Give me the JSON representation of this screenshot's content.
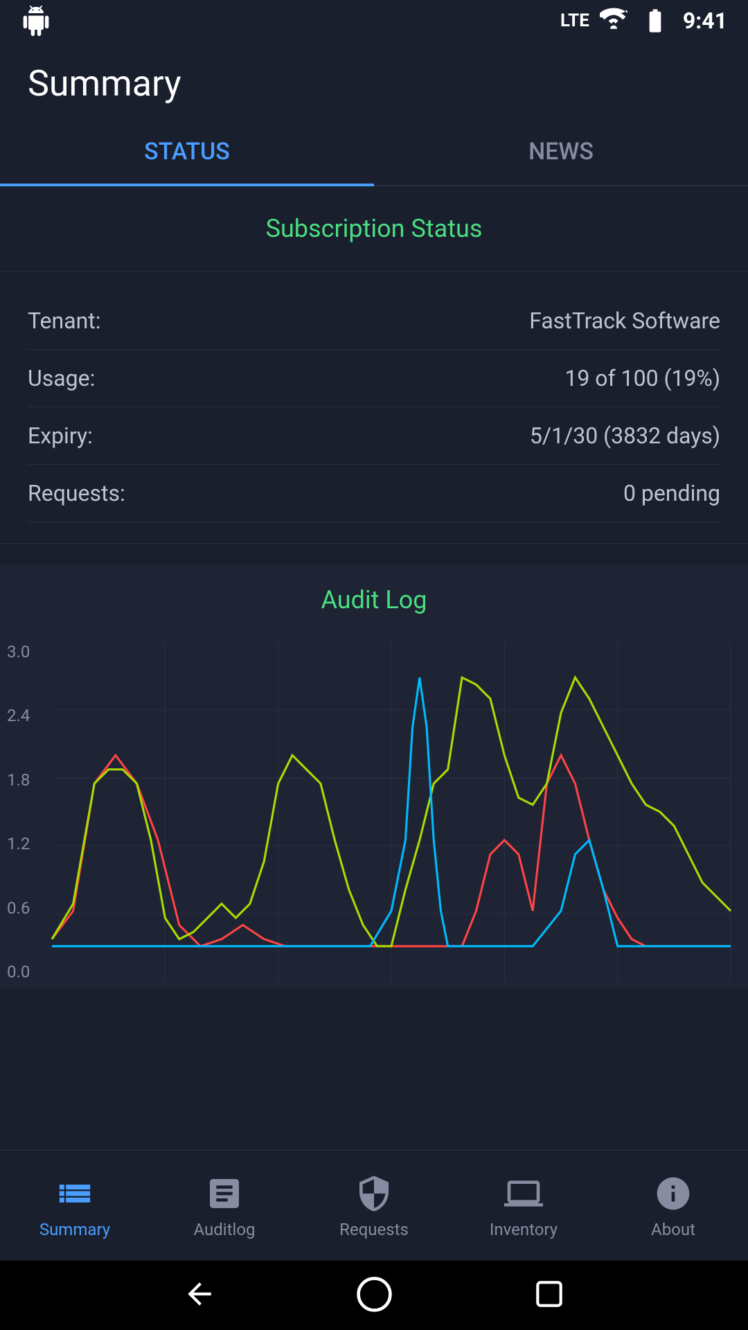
{
  "statusBar": {
    "time": "9:41",
    "networkType": "LTE"
  },
  "header": {
    "title": "Summary"
  },
  "tabs": [
    {
      "id": "status",
      "label": "STATUS",
      "active": true
    },
    {
      "id": "news",
      "label": "NEWS",
      "active": false
    }
  ],
  "subscriptionStatus": {
    "sectionTitle": "Subscription Status",
    "fields": [
      {
        "label": "Tenant:",
        "value": "FastTrack Software"
      },
      {
        "label": "Usage:",
        "value": "19 of 100 (19%)"
      },
      {
        "label": "Expiry:",
        "value": "5/1/30 (3832 days)"
      },
      {
        "label": "Requests:",
        "value": "0 pending"
      }
    ]
  },
  "auditLog": {
    "sectionTitle": "Audit Log",
    "yAxis": [
      "3.0",
      "2.4",
      "1.8",
      "1.2",
      "0.6",
      "0.0"
    ],
    "chart": {
      "lines": [
        {
          "color": "#ff4444",
          "label": "red-line"
        },
        {
          "color": "#aadd00",
          "label": "green-line"
        },
        {
          "color": "#00bbff",
          "label": "blue-line"
        }
      ]
    }
  },
  "bottomNav": [
    {
      "id": "summary",
      "label": "Summary",
      "active": true,
      "icon": "list-icon"
    },
    {
      "id": "auditlog",
      "label": "Auditlog",
      "active": false,
      "icon": "auditlog-icon"
    },
    {
      "id": "requests",
      "label": "Requests",
      "active": false,
      "icon": "shield-icon"
    },
    {
      "id": "inventory",
      "label": "Inventory",
      "active": false,
      "icon": "monitor-icon"
    },
    {
      "id": "about",
      "label": "About",
      "active": false,
      "icon": "info-icon"
    }
  ]
}
